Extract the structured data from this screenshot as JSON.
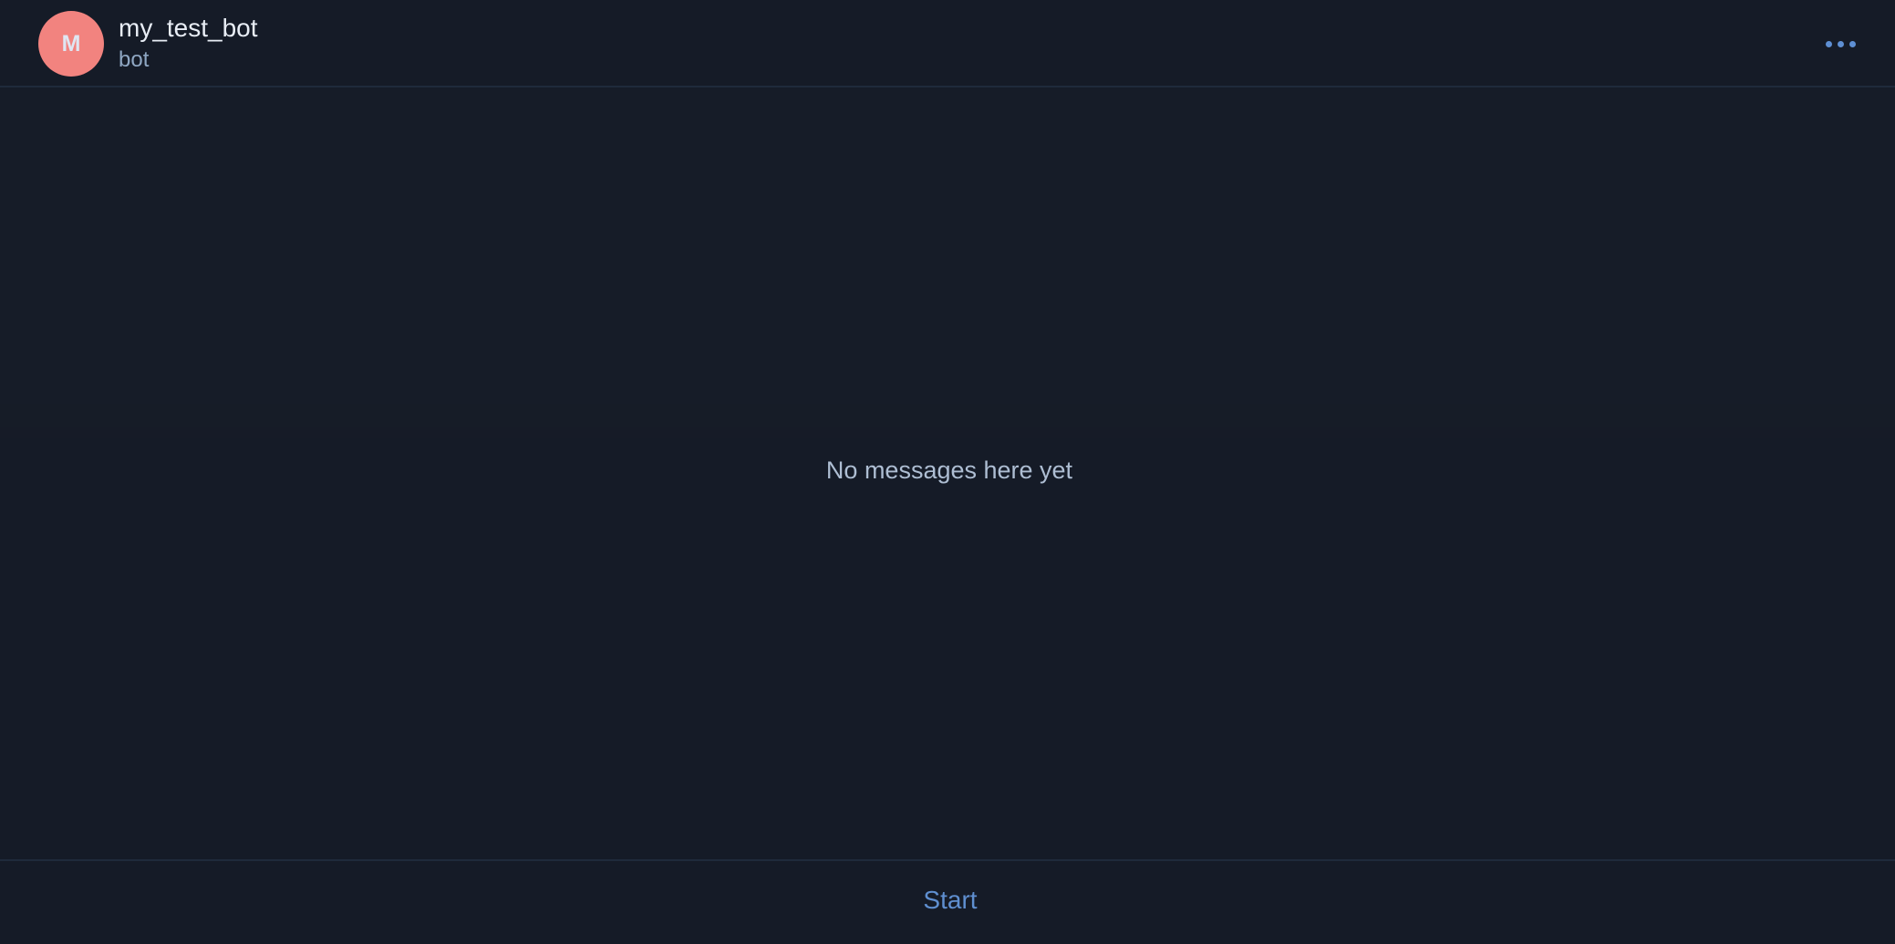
{
  "header": {
    "avatar_initial": "M",
    "title": "my_test_bot",
    "subtitle": "bot",
    "menu_icon": "more-horizontal-icon",
    "avatar_color": "#f2837f",
    "accent_color": "#5e8fd3"
  },
  "messages": {
    "empty_text": "No messages here yet"
  },
  "composer": {
    "start_label": "Start",
    "start_color": "#5f8fd0"
  }
}
